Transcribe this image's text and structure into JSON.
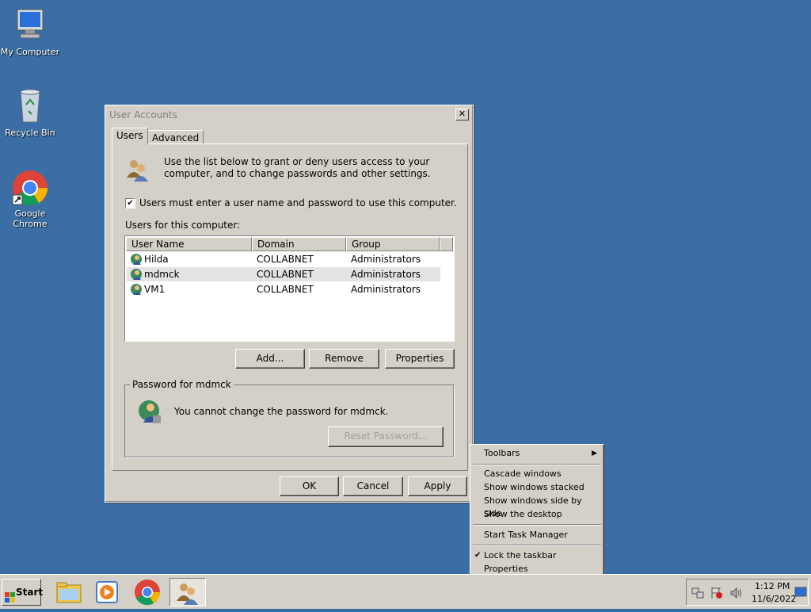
{
  "desktop": {
    "icons": [
      {
        "label": "My Computer"
      },
      {
        "label": "Recycle Bin"
      },
      {
        "label": "Google Chrome"
      }
    ]
  },
  "window": {
    "title": "User Accounts",
    "close_glyph": "✕",
    "tabs": [
      {
        "label": "Users"
      },
      {
        "label": "Advanced"
      }
    ],
    "intro": "Use the list below to grant or deny users access to your computer, and to change passwords and other settings.",
    "checkbox_label": "Users must enter a user name and password to use this computer.",
    "checkbox_checked": true,
    "list_label": "Users for this computer:",
    "columns": [
      "User Name",
      "Domain",
      "Group"
    ],
    "rows": [
      {
        "name": "Hilda",
        "domain": "COLLABNET",
        "group": "Administrators"
      },
      {
        "name": "mdmck",
        "domain": "COLLABNET",
        "group": "Administrators"
      },
      {
        "name": "VM1",
        "domain": "COLLABNET",
        "group": "Administrators"
      }
    ],
    "selected_row": 1,
    "buttons": {
      "add": "Add...",
      "remove": "Remove",
      "properties": "Properties"
    },
    "password_group": {
      "title": "Password for mdmck",
      "message": "You cannot change the password for mdmck.",
      "reset_button": "Reset Password..."
    },
    "footer": {
      "ok": "OK",
      "cancel": "Cancel",
      "apply": "Apply"
    }
  },
  "context_menu": {
    "items": [
      {
        "label": "Toolbars",
        "submenu": true
      },
      {
        "label": "Cascade windows"
      },
      {
        "label": "Show windows stacked"
      },
      {
        "label": "Show windows side by side"
      },
      {
        "label": "Show the desktop"
      },
      {
        "label": "Start Task Manager"
      },
      {
        "label": "Lock the taskbar",
        "checked": true
      },
      {
        "label": "Properties"
      }
    ]
  },
  "taskbar": {
    "start_label": "Start",
    "clock_time": "1:12 PM",
    "clock_date": "11/6/2022"
  },
  "colors": {
    "desktop": "#3a6ea5",
    "face": "#d4d0c8"
  }
}
